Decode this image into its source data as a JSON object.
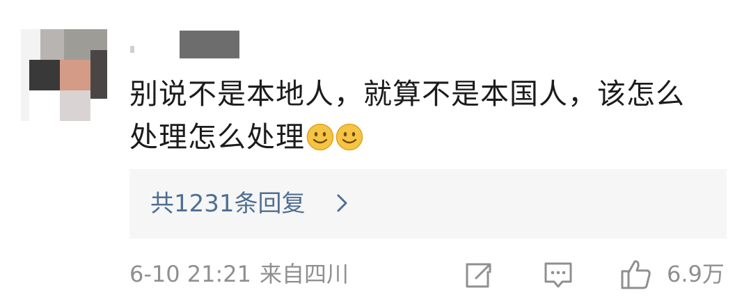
{
  "comment": {
    "line1": "别说不是本地人，就算不是本国人，该怎么",
    "line2": "处理怎么处理",
    "emojis": [
      "smile-emoji",
      "smile-emoji"
    ]
  },
  "replies": {
    "label": "共1231条回复",
    "link_color": "#4e6f93"
  },
  "footer": {
    "timestamp": "6-10 21:21",
    "source": "来自四川",
    "like_count": "6.9万"
  },
  "icons": {
    "forward": "share-edit-icon",
    "comment": "comment-icon",
    "like": "thumbs-up-icon"
  },
  "colors": {
    "text": "#1c1c1c",
    "meta": "#8f8f8f",
    "panel": "#f6f6f6",
    "emoji": "#f6c443"
  }
}
